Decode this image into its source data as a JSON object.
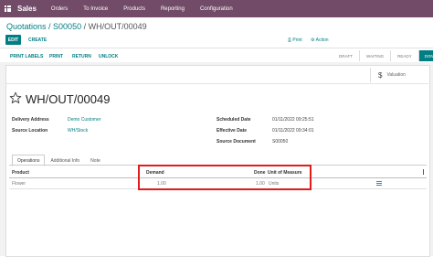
{
  "nav": {
    "app": "Sales",
    "menus": [
      "Orders",
      "To Invoice",
      "Products",
      "Reporting",
      "Configuration"
    ]
  },
  "breadcrumb": {
    "parent1": "Quotations",
    "sep1": " / ",
    "parent2": "S00050",
    "sep2": " / ",
    "current": "WH/OUT/00049"
  },
  "control": {
    "edit": "EDIT",
    "create": "CREATE",
    "print": "Print",
    "action": "Action"
  },
  "actions": {
    "print_labels": "PRINT LABELS",
    "print": "PRINT",
    "return": "RETURN",
    "unlock": "UNLOCK"
  },
  "status": {
    "steps": [
      "DRAFT",
      "WAITING",
      "READY",
      "DONE"
    ],
    "active": "DONE"
  },
  "smart_button": {
    "valuation": "Valuation"
  },
  "record": {
    "title": "WH/OUT/00049",
    "delivery_address_label": "Delivery Address",
    "delivery_address": "Demo Customer",
    "source_location_label": "Source Location",
    "source_location": "WH/Stock",
    "scheduled_date_label": "Scheduled Date",
    "scheduled_date": "01/11/2022 09:25:51",
    "effective_date_label": "Effective Date",
    "effective_date": "01/11/2022 09:34:01",
    "source_document_label": "Source Document",
    "source_document": "S00050"
  },
  "tabs": [
    "Operations",
    "Additional Info",
    "Note"
  ],
  "table": {
    "headers": {
      "product": "Product",
      "demand": "Demand",
      "done": "Done",
      "uom": "Unit of Measure"
    },
    "rows": [
      {
        "product": "Flower",
        "demand": "1.00",
        "done": "1.00",
        "uom": "Units"
      }
    ]
  },
  "colors": {
    "nav": "#714B67",
    "primary": "#017e84",
    "highlight": "#e21b1b"
  }
}
